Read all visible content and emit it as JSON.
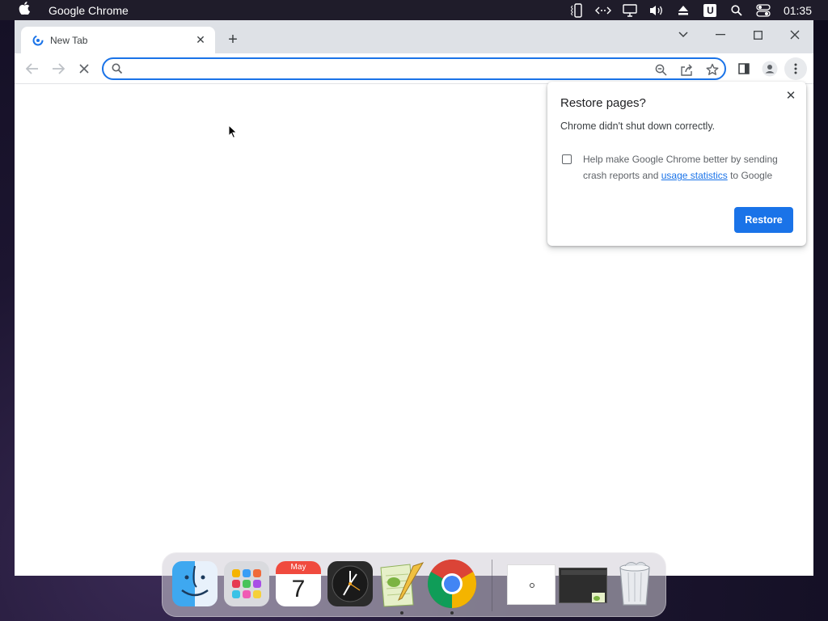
{
  "menubar": {
    "app_name": "Google Chrome",
    "clock": "01:35",
    "u_badge": "U",
    "icons": [
      "apple-icon",
      "phone-icon",
      "remote-icon",
      "display-icon",
      "volume-icon",
      "eject-icon",
      "u-icon",
      "spotlight-icon",
      "control-center-icon"
    ]
  },
  "browser": {
    "tab_title": "New Tab",
    "omnibox_value": "",
    "omnibox_placeholder": "",
    "accent_color": "#1a73e8"
  },
  "popup": {
    "title": "Restore pages?",
    "message": "Chrome didn't shut down correctly.",
    "consent_before": "Help make Google Chrome better by sending crash reports and ",
    "consent_link": "usage statistics",
    "consent_after": " to Google",
    "checkbox_checked": false,
    "restore_label": "Restore"
  },
  "dock": {
    "calendar_month": "May",
    "calendar_day": "7",
    "items": [
      "Finder",
      "Launchpad",
      "Calendar",
      "Clock",
      "Notepad",
      "Google Chrome",
      "Window thumbnail",
      "Window thumbnail",
      "Trash"
    ]
  }
}
